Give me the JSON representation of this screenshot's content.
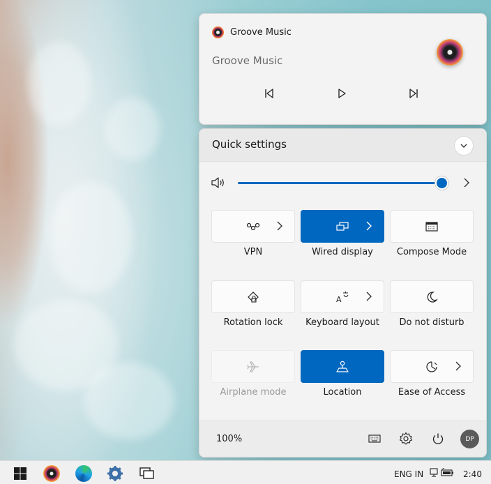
{
  "media": {
    "app_name": "Groove Music",
    "title": "Groove Music",
    "icons": [
      "previous-track-icon",
      "play-icon",
      "next-track-icon"
    ]
  },
  "quick_settings": {
    "title": "Quick settings",
    "volume": {
      "level_percent": 100
    },
    "tiles": [
      {
        "label": "VPN",
        "icon": "vpn-icon",
        "state": "off",
        "has_arrow": true
      },
      {
        "label": "Wired display",
        "icon": "cast-icon",
        "state": "on",
        "has_arrow": true
      },
      {
        "label": "Compose Mode",
        "icon": "keyboard-icon",
        "state": "off",
        "has_arrow": false
      },
      {
        "label": "Rotation lock",
        "icon": "rotation-lock-icon",
        "state": "off",
        "has_arrow": false
      },
      {
        "label": "Keyboard layout",
        "icon": "language-icon",
        "state": "off",
        "has_arrow": true
      },
      {
        "label": "Do not disturb",
        "icon": "moon-icon",
        "state": "off",
        "has_arrow": false
      },
      {
        "label": "Airplane mode",
        "icon": "airplane-icon",
        "state": "disabled",
        "has_arrow": false
      },
      {
        "label": "Location",
        "icon": "location-icon",
        "state": "on",
        "has_arrow": false
      },
      {
        "label": "Ease of Access",
        "icon": "accessibility-icon",
        "state": "off",
        "has_arrow": true
      }
    ],
    "footer": {
      "battery": "100%",
      "avatar_initials": "DP"
    }
  },
  "taskbar": {
    "apps": [
      "windows-start-icon",
      "groove-music-icon",
      "edge-icon",
      "settings-icon",
      "task-view-icon"
    ],
    "tray": {
      "language": "ENG IN",
      "time": "2:40"
    }
  },
  "colors": {
    "accent": "#0067c0",
    "panel": "#f3f3f3"
  }
}
